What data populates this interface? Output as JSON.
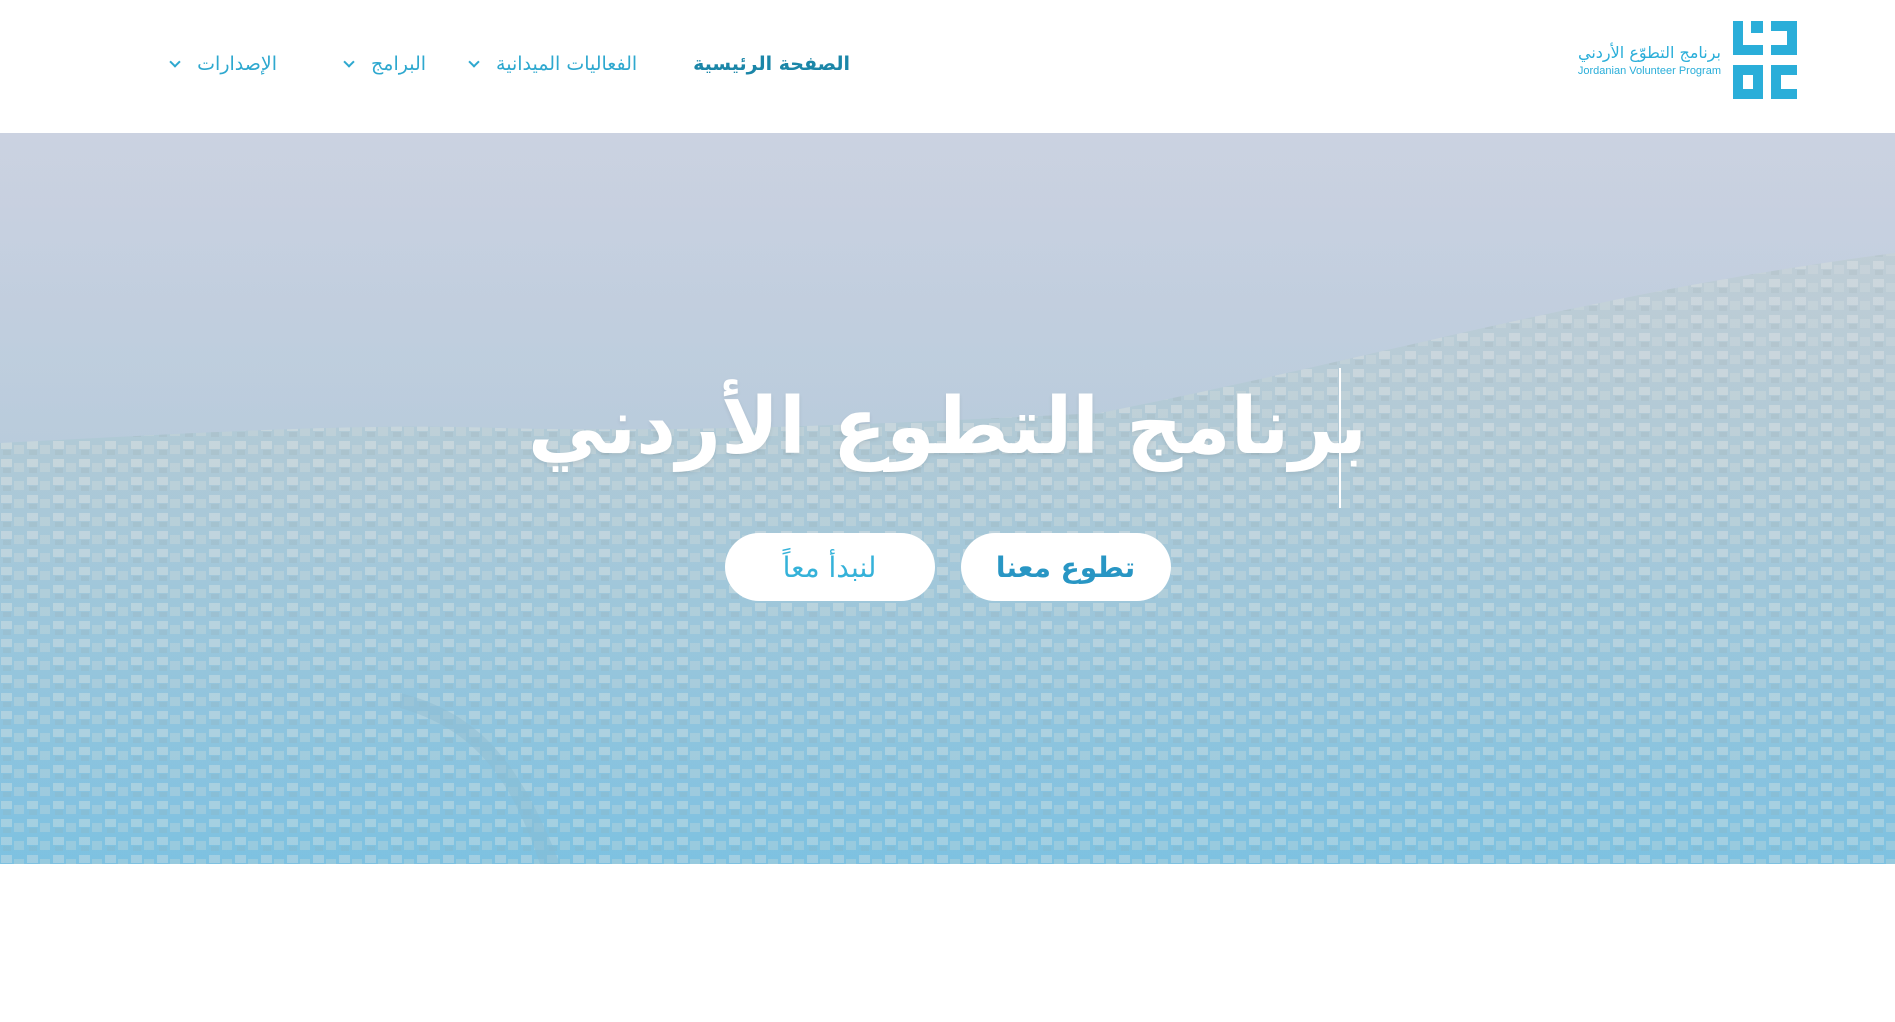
{
  "nav": {
    "items": [
      {
        "label": "الصفحة الرئيسية",
        "has_dropdown": false,
        "active": true
      },
      {
        "label": "الفعاليات الميدانية",
        "has_dropdown": true,
        "active": false
      },
      {
        "label": "البرامج",
        "has_dropdown": true,
        "active": false
      },
      {
        "label": "الإصدارات",
        "has_dropdown": true,
        "active": false
      }
    ]
  },
  "logo": {
    "arabic": "برنامج التطوّع الأردني",
    "english": "Jordanian Volunteer Program"
  },
  "hero": {
    "title": "برنامج التطوع الأردني",
    "buttons": {
      "volunteer": "تطوع معنا",
      "start": "لنبدأ معاً"
    }
  },
  "colors": {
    "brand": "#2aaed9",
    "nav_text": "#2ea8cf",
    "nav_active": "#1b86a8"
  }
}
